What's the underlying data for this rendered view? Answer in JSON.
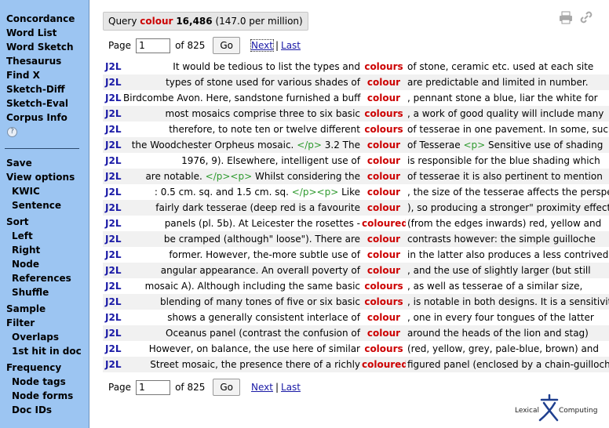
{
  "sidebar": {
    "nav": [
      {
        "label": "Concordance",
        "name": "sidebar-item-concordance"
      },
      {
        "label": "Word List",
        "name": "sidebar-item-word-list"
      },
      {
        "label": "Word Sketch",
        "name": "sidebar-item-word-sketch"
      },
      {
        "label": "Thesaurus",
        "name": "sidebar-item-thesaurus"
      },
      {
        "label": "Find X",
        "name": "sidebar-item-find-x"
      },
      {
        "label": "Sketch-Diff",
        "name": "sidebar-item-sketch-diff"
      },
      {
        "label": "Sketch-Eval",
        "name": "sidebar-item-sketch-eval"
      },
      {
        "label": "Corpus Info",
        "name": "sidebar-item-corpus-info"
      }
    ],
    "help": "?",
    "tools": [
      {
        "label": "Save",
        "sub": false
      },
      {
        "label": "View options",
        "sub": false
      },
      {
        "label": "KWIC",
        "sub": true
      },
      {
        "label": "Sentence",
        "sub": true
      },
      {
        "gap": true
      },
      {
        "label": "Sort",
        "sub": false
      },
      {
        "label": "Left",
        "sub": true
      },
      {
        "label": "Right",
        "sub": true
      },
      {
        "label": "Node",
        "sub": true
      },
      {
        "label": "References",
        "sub": true
      },
      {
        "label": "Shuffle",
        "sub": true
      },
      {
        "gap": true
      },
      {
        "label": "Sample",
        "sub": false
      },
      {
        "label": "Filter",
        "sub": false
      },
      {
        "label": "Overlaps",
        "sub": true
      },
      {
        "label": "1st hit in doc",
        "sub": true
      },
      {
        "gap": true
      },
      {
        "label": "Frequency",
        "sub": false
      },
      {
        "label": "Node tags",
        "sub": true
      },
      {
        "label": "Node forms",
        "sub": true
      },
      {
        "label": "Doc IDs",
        "sub": true
      }
    ]
  },
  "query": {
    "label": "Query",
    "word": "colour",
    "count": "16,486",
    "rate": "(147.0 per million)"
  },
  "pager": {
    "page_label": "Page",
    "page_value": "1",
    "of_text": "of 825",
    "go_label": "Go",
    "next_label": "Next",
    "last_label": "Last",
    "separator": "|"
  },
  "rows": [
    {
      "ref": "J2L",
      "left": [
        {
          "t": "It would be tedious to list the types and"
        }
      ],
      "kw": "colours",
      "right": [
        {
          "t": "of stone, ceramic etc. used at each site"
        }
      ]
    },
    {
      "ref": "J2L",
      "left": [
        {
          "t": "types of stone used for various shades of"
        }
      ],
      "kw": "colour",
      "right": [
        {
          "t": "are predictable and limited in number."
        }
      ]
    },
    {
      "ref": "J2L",
      "left": [
        {
          "t": "Birdcombe Avon. Here, sandstone furnished a buff"
        }
      ],
      "kw": "colour",
      "right": [
        {
          "t": ", pennant stone a blue, liar the white for"
        }
      ]
    },
    {
      "ref": "J2L",
      "left": [
        {
          "t": "most mosaics comprise three to six basic"
        }
      ],
      "kw": "colours",
      "right": [
        {
          "t": ", a work of good quality will include many"
        }
      ]
    },
    {
      "ref": "J2L",
      "left": [
        {
          "t": "therefore, to note ten or twelve different"
        }
      ],
      "kw": "colours",
      "right": [
        {
          "t": "of tesserae in one pavement. In some, such"
        }
      ]
    },
    {
      "ref": "J2L",
      "left": [
        {
          "t": "the Woodchester Orpheus mosaic. "
        },
        {
          "t": "</p>",
          "tag": true
        },
        {
          "t": " 3.2 The"
        }
      ],
      "kw": "colour",
      "right": [
        {
          "t": "of Tesserae "
        },
        {
          "t": "<p>",
          "tag": true
        },
        {
          "t": " Sensitive use of shading"
        }
      ]
    },
    {
      "ref": "J2L",
      "left": [
        {
          "t": "1976, 9). Elsewhere, intelligent use of"
        }
      ],
      "kw": "colour",
      "right": [
        {
          "t": "is responsible for the blue shading which"
        }
      ]
    },
    {
      "ref": "J2L",
      "left": [
        {
          "t": "are notable. "
        },
        {
          "t": "</p><p>",
          "tag": true
        },
        {
          "t": " Whilst considering the"
        }
      ],
      "kw": "colour",
      "right": [
        {
          "t": "of tesserae it is also pertinent to mention"
        }
      ]
    },
    {
      "ref": "J2L",
      "left": [
        {
          "t": ": 0.5 cm. sq. and 1.5 cm. sq. "
        },
        {
          "t": "</p><p>",
          "tag": true
        },
        {
          "t": " Like"
        }
      ],
      "kw": "colour",
      "right": [
        {
          "t": ", the size of the tesserae affects the perspective"
        }
      ]
    },
    {
      "ref": "J2L",
      "left": [
        {
          "t": "fairly dark tesserae (deep red is a favourite"
        }
      ],
      "kw": "colour",
      "right": [
        {
          "t": "), so producing a stronger\" proximity effect"
        }
      ]
    },
    {
      "ref": "J2L",
      "left": [
        {
          "t": "panels (pl. 5b). At Leicester the rosettes -"
        }
      ],
      "kw": "coloured",
      "right": [
        {
          "t": "(from the edges inwards) red, yellow and"
        }
      ]
    },
    {
      "ref": "J2L",
      "left": [
        {
          "t": "be cramped (although\" loose\"). There are"
        }
      ],
      "kw": "colour",
      "right": [
        {
          "t": "contrasts however: the simple guilloche"
        }
      ]
    },
    {
      "ref": "J2L",
      "left": [
        {
          "t": "former. However, the-more subtle use of"
        }
      ],
      "kw": "colour",
      "right": [
        {
          "t": "in the latter also produces a less contrived"
        }
      ]
    },
    {
      "ref": "J2L",
      "left": [
        {
          "t": "angular appearance. An overall poverty of"
        }
      ],
      "kw": "colour",
      "right": [
        {
          "t": ", and the use of slightly larger (but still"
        }
      ]
    },
    {
      "ref": "J2L",
      "left": [
        {
          "t": "mosaic A). Although including the same basic"
        }
      ],
      "kw": "colours",
      "right": [
        {
          "t": ", as well as tesserae of a similar size,"
        }
      ]
    },
    {
      "ref": "J2L",
      "left": [
        {
          "t": "blending of many tones of five or six basic"
        }
      ],
      "kw": "colours",
      "right": [
        {
          "t": ", is notable in both designs. It is a sensitivity"
        }
      ]
    },
    {
      "ref": "J2L",
      "left": [
        {
          "t": "shows a generally consistent interlace of"
        }
      ],
      "kw": "colour",
      "right": [
        {
          "t": ", one in every four tongues of the latter"
        }
      ]
    },
    {
      "ref": "J2L",
      "left": [
        {
          "t": "Oceanus panel (contrast the confusion of"
        }
      ],
      "kw": "colour",
      "right": [
        {
          "t": "around the heads of the lion and stag)"
        }
      ]
    },
    {
      "ref": "J2L",
      "left": [
        {
          "t": "However, on balance, the use here of similar"
        }
      ],
      "kw": "colours",
      "right": [
        {
          "t": "(red, yellow, grey, pale-blue, brown) and"
        }
      ]
    },
    {
      "ref": "J2L",
      "left": [
        {
          "t": "Street mosaic, the presence there of a richly"
        }
      ],
      "kw": "coloured",
      "right": [
        {
          "t": "figured panel (enclosed by a chain-guilloche"
        }
      ]
    }
  ],
  "logo": {
    "part1": "Lexical",
    "part2": "Computing"
  },
  "icons": {
    "print": "print-icon",
    "link": "link-icon",
    "copy": "copy-icon"
  },
  "colors": {
    "sidebar_bg": "#9cc5f2",
    "keyword": "#cc0000",
    "link": "#1a1aa6",
    "tag": "#2e9a2e"
  }
}
